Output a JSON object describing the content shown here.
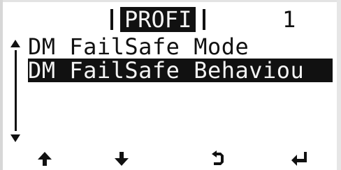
{
  "header": {
    "title": "PROFI",
    "page_number": "1"
  },
  "menu": {
    "items": [
      {
        "label": "DM FailSafe Mode",
        "selected": false
      },
      {
        "label": "DM FailSafe Behaviou",
        "selected": true
      }
    ]
  },
  "softkeys": {
    "icons": [
      "arrow-up-icon",
      "arrow-down-icon",
      "back-icon",
      "enter-icon"
    ]
  },
  "colors": {
    "lcd_text": "#111111",
    "lcd_background": "#ffffff",
    "highlight_text": "#f4f4f4"
  }
}
